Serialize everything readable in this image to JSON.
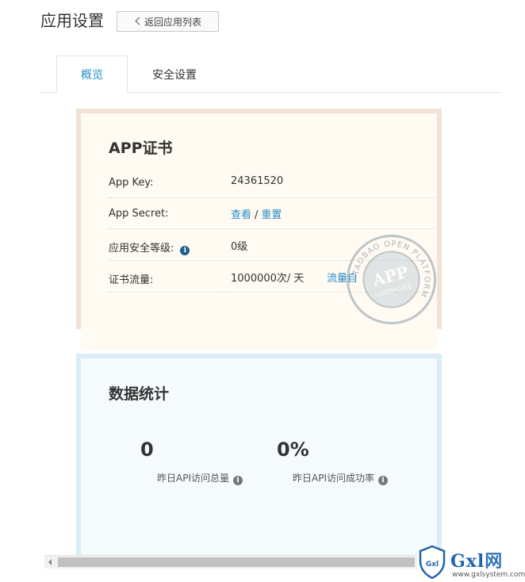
{
  "header": {
    "title": "应用设置",
    "back_label": "返回应用列表"
  },
  "tabs": [
    {
      "label": "概览",
      "active": true
    },
    {
      "label": "安全设置",
      "active": false
    }
  ],
  "cert": {
    "heading": "APP证书",
    "rows": [
      {
        "key": "App Key:",
        "value": "24361520"
      },
      {
        "key": "App Secret:",
        "links": [
          "查看",
          "重置"
        ],
        "separator": "/"
      },
      {
        "key": "应用安全等级:",
        "value": "0级"
      },
      {
        "key": "证书流量:",
        "value": "1000000次/ 天",
        "link": "流量自"
      }
    ],
    "stamp": {
      "ring_text": "TAOBAO OPEN PLATFORM",
      "center": "APP",
      "sub": "CERTIFICATE"
    }
  },
  "stats": {
    "heading": "数据统计",
    "items": [
      {
        "value": "0",
        "label": "昨日API访问总量"
      },
      {
        "value": "0%",
        "label": "昨日API访问成功率"
      }
    ]
  },
  "watermark": {
    "brand": "Gxl",
    "suffix": "网",
    "shield": "Gxl",
    "url": "www.gxlsystem.com"
  },
  "colors": {
    "link": "#2a8ec8",
    "cert_border": "#f1e2d6",
    "cert_bg": "#fffaf2",
    "stats_border": "#d9ecf7",
    "stats_bg": "#f5fafd"
  }
}
